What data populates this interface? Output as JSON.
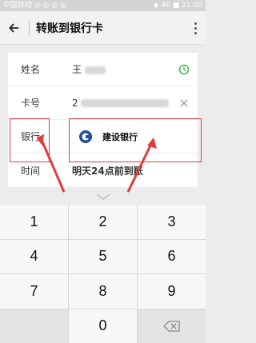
{
  "status_bar": {
    "left": "中国移动 ◎ ◎ ◎ ◎",
    "right": "◆ 46 ■ 21:00"
  },
  "app_bar": {
    "title": "转账到银行卡"
  },
  "form": {
    "name": {
      "label": "姓名",
      "value": "王"
    },
    "card": {
      "label": "卡号",
      "value": "2"
    },
    "bank": {
      "label": "银行",
      "value": "建设银行"
    },
    "time": {
      "label": "时间",
      "value": "明天24点前到账"
    }
  },
  "keypad": {
    "keys": [
      "1",
      "2",
      "3",
      "4",
      "5",
      "6",
      "7",
      "8",
      "9",
      "",
      "0",
      "⌫"
    ]
  },
  "colors": {
    "highlight": "#e23c3c",
    "time_accent": "#f0a020",
    "clock_green": "#3cb34a",
    "bank_blue": "#1f4e9b"
  }
}
